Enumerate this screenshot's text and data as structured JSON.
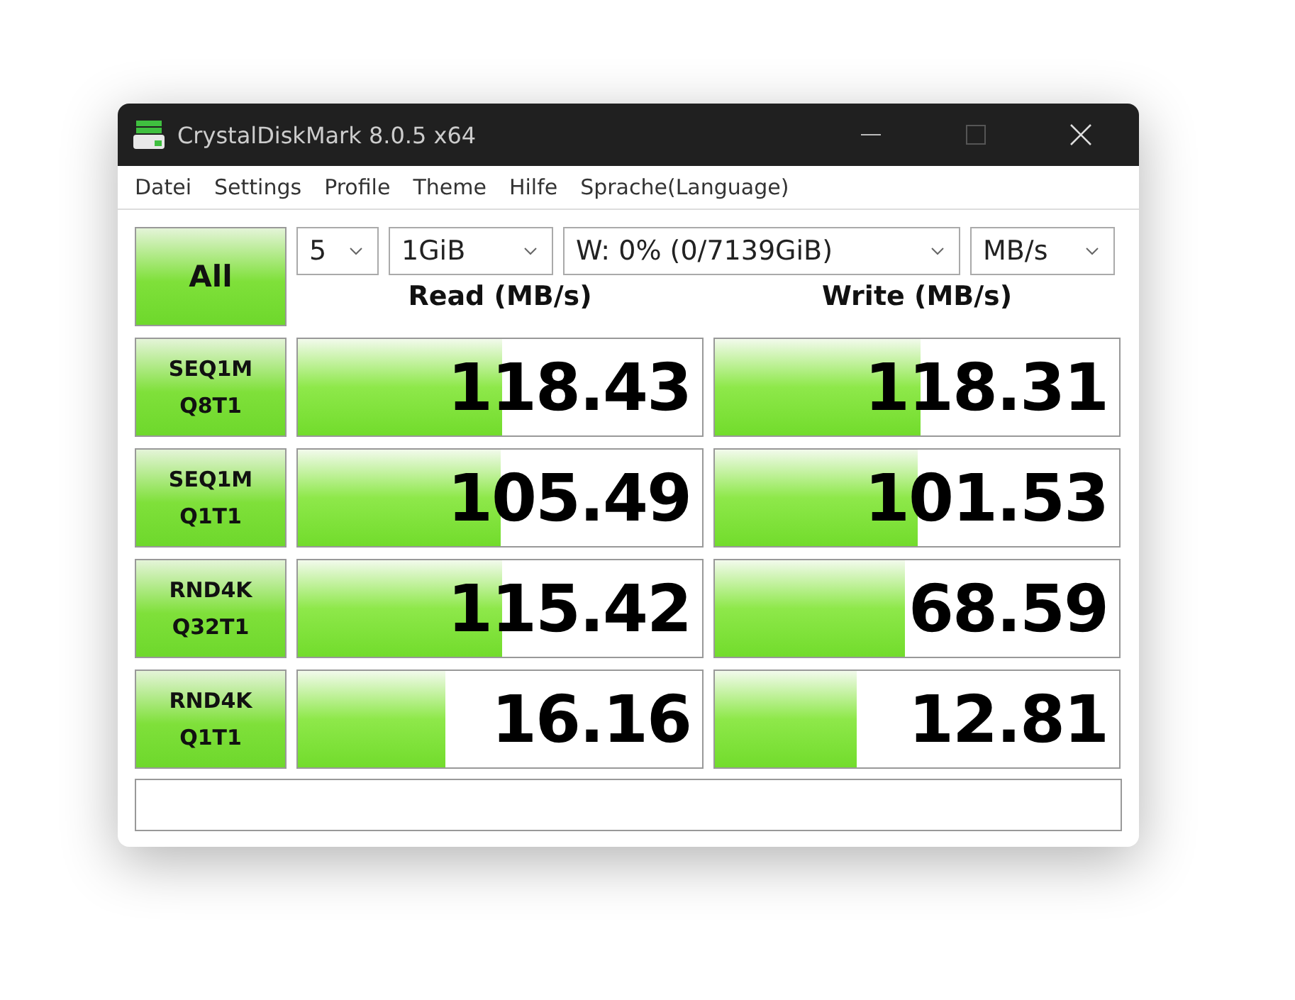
{
  "window": {
    "title": "CrystalDiskMark 8.0.5 x64"
  },
  "menu": [
    "Datei",
    "Settings",
    "Profile",
    "Theme",
    "Hilfe",
    "Sprache(Language)"
  ],
  "all_button": "All",
  "selects": [
    {
      "value": "5"
    },
    {
      "value": "1GiB"
    },
    {
      "value": "W: 0% (0/7139GiB)"
    },
    {
      "value": "MB/s"
    }
  ],
  "columns": [
    "Read (MB/s)",
    "Write (MB/s)"
  ],
  "rows": [
    {
      "test": [
        "SEQ1M",
        "Q8T1"
      ],
      "read": {
        "value": "118.43",
        "level": 0.505
      },
      "write": {
        "value": "118.31",
        "level": 0.51
      }
    },
    {
      "test": [
        "SEQ1M",
        "Q1T1"
      ],
      "read": {
        "value": "105.49",
        "level": 0.5
      },
      "write": {
        "value": "101.53",
        "level": 0.5
      }
    },
    {
      "test": [
        "RND4K",
        "Q32T1"
      ],
      "read": {
        "value": "115.42",
        "level": 0.505
      },
      "write": {
        "value": "68.59",
        "level": 0.47
      }
    },
    {
      "test": [
        "RND4K",
        "Q1T1"
      ],
      "read": {
        "value": "16.16",
        "level": 0.366
      },
      "write": {
        "value": "12.81",
        "level": 0.35
      }
    }
  ]
}
